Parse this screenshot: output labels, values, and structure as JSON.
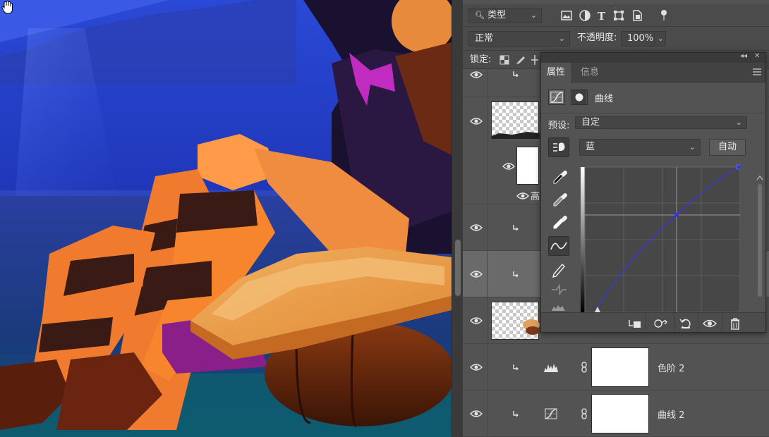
{
  "layers_toolbar": {
    "kind_filter": "类型",
    "blend_mode": "正常",
    "opacity_label": "不透明度:",
    "opacity_value": "100%",
    "lock_label": "锁定:",
    "filter_icons": [
      "image-filter-icon",
      "adjustment-filter-icon",
      "type-filter-icon",
      "shape-filter-icon",
      "smart-object-filter-icon",
      "filter-toggle-icon"
    ]
  },
  "layers": {
    "partial_mask_label": "高",
    "levels_layer": "色阶 2",
    "curves_layer": "曲线 2"
  },
  "properties": {
    "tab_properties": "属性",
    "tab_info": "信息",
    "panel_title": "曲线",
    "preset_label": "预设:",
    "preset_value": "自定",
    "channel_value": "蓝",
    "auto_button": "自动",
    "curve_color": "#3a37d8"
  },
  "colors": {
    "panel_bg": "#535353",
    "selected_row": "#6a6a6a",
    "sky": "#1d2fa8"
  }
}
